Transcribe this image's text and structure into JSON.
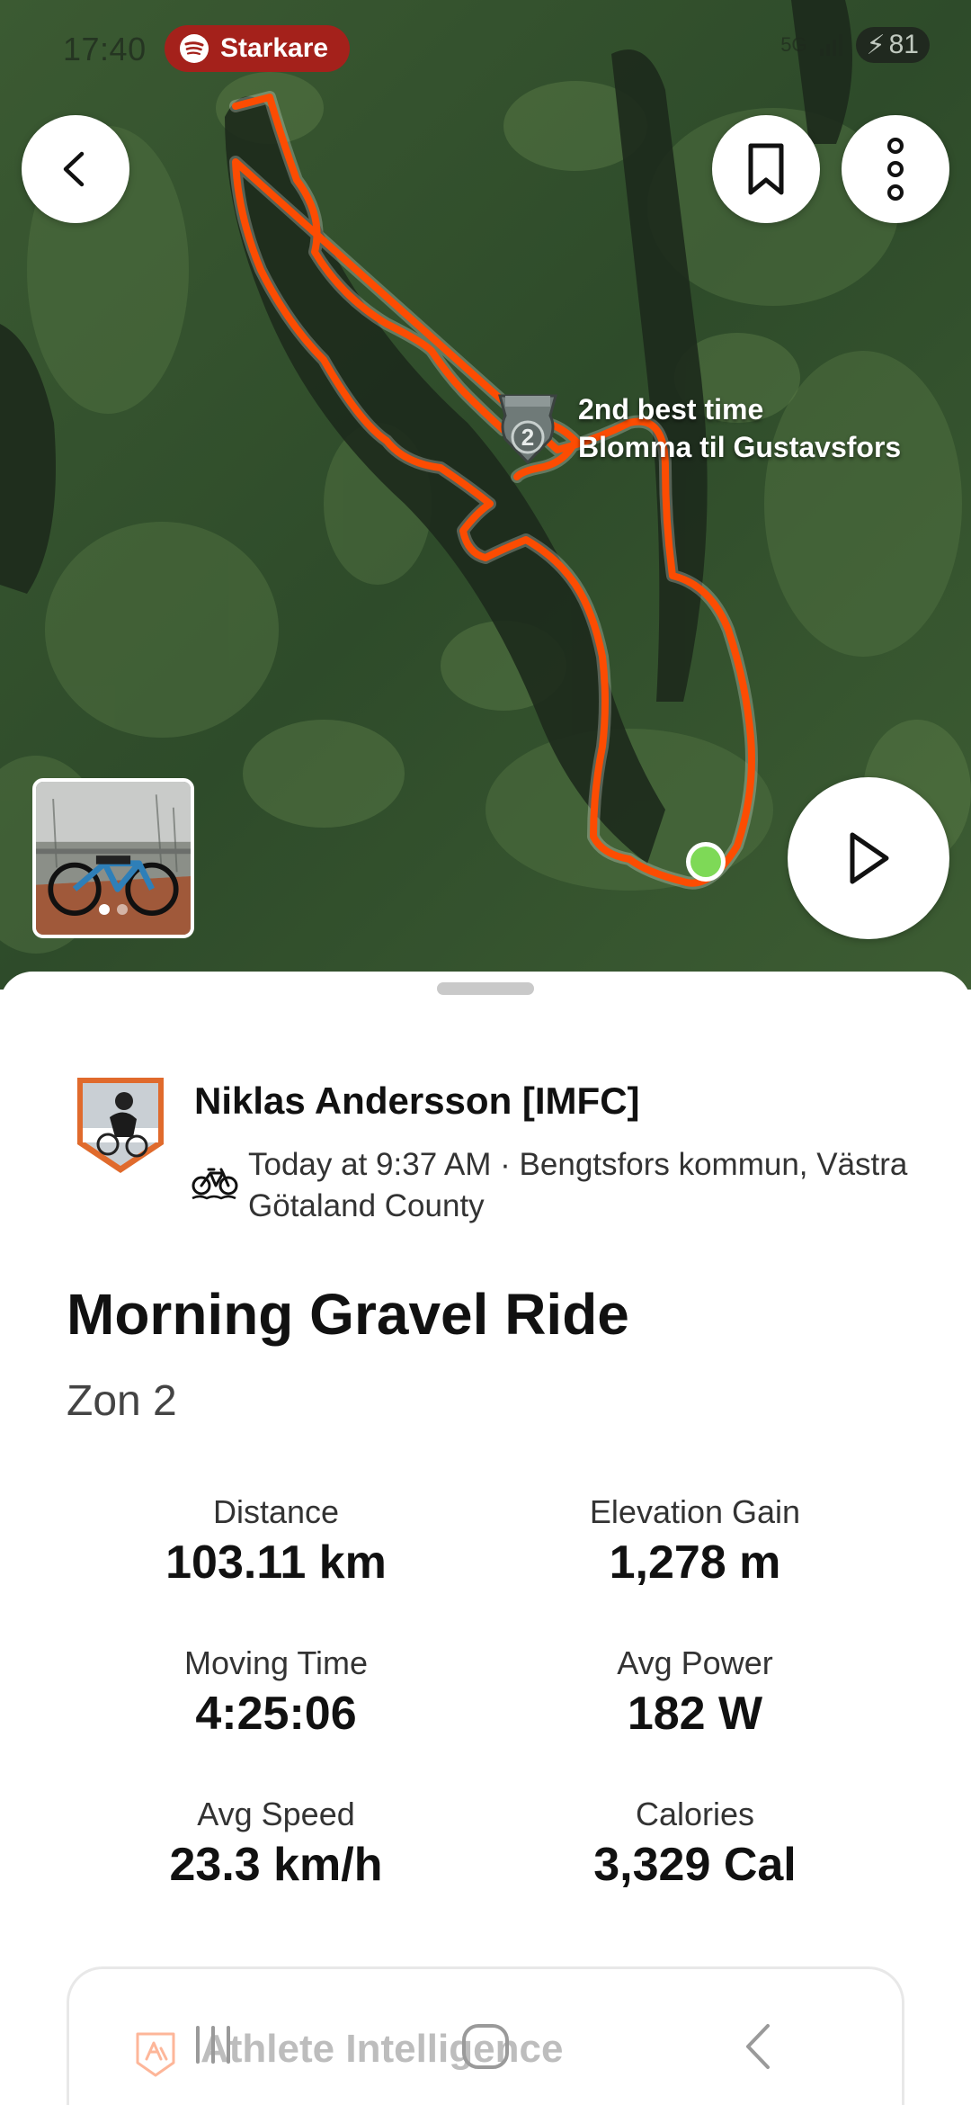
{
  "status_bar": {
    "time": "17:40",
    "spotify_label": "Starkare",
    "network": "5G",
    "battery": "81"
  },
  "map": {
    "segment_rank": "2",
    "segment_line1": "2nd best time",
    "segment_line2": "Blomma til Gustavsfors",
    "colors": {
      "route": "#fc4c02",
      "start_marker": "#7ed957"
    }
  },
  "athlete": {
    "name": "Niklas Andersson [IMFC]",
    "meta": "Today at 9:37 AM · Bengtsfors kommun, Västra Götaland County",
    "activity_icon": "gravel-bike-icon"
  },
  "activity": {
    "title": "Morning Gravel Ride",
    "description": "Zon 2"
  },
  "stats": [
    {
      "label": "Distance",
      "value": "103.11 km"
    },
    {
      "label": "Elevation Gain",
      "value": "1,278 m"
    },
    {
      "label": "Moving Time",
      "value": "4:25:06"
    },
    {
      "label": "Avg Power",
      "value": "182 W"
    },
    {
      "label": "Avg Speed",
      "value": "23.3 km/h"
    },
    {
      "label": "Calories",
      "value": "3,329 Cal"
    }
  ],
  "athlete_intelligence": {
    "title": "Athlete Intelligence"
  }
}
